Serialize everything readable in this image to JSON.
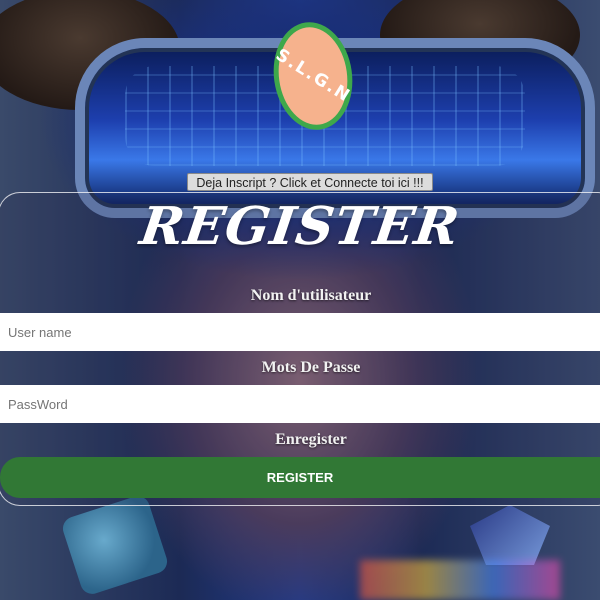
{
  "logo": {
    "text": "S.L.G.N",
    "colors": {
      "fill": "#f6b28d",
      "ring": "#3ea84b"
    }
  },
  "switch_link": {
    "label": "Deja Inscript ? Click et Connecte toi ici !!!"
  },
  "form": {
    "title": "REGISTER",
    "username": {
      "label": "Nom d'utilisateur",
      "placeholder": "User name",
      "value": ""
    },
    "password": {
      "label": "Mots De Passe",
      "placeholder": "PassWord",
      "value": ""
    },
    "submit": {
      "label": "Enregister",
      "button_label": "REGISTER"
    }
  },
  "colors": {
    "accent": "#317835",
    "text": "#ffffff"
  }
}
